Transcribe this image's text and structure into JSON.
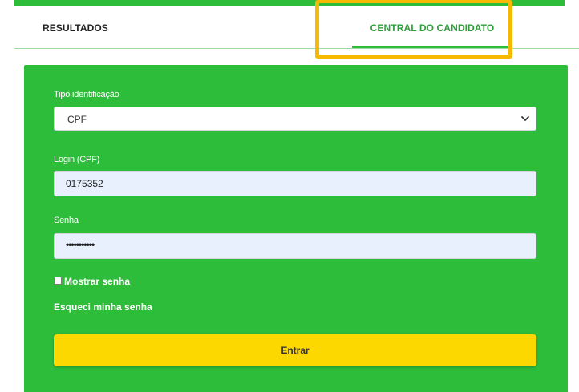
{
  "nav": {
    "tabs": [
      {
        "label": "RESULTADOS",
        "active": false
      },
      {
        "label": "CENTRAL DO CANDIDATO",
        "active": true
      }
    ],
    "highlight_color": "#f6b800"
  },
  "form": {
    "tipo_label": "Tipo identificação",
    "tipo_value": "CPF",
    "login_label": "Login (CPF)",
    "login_value": "0175352",
    "senha_label": "Senha",
    "senha_value": "•••••••••••",
    "show_password_label": "Mostrar senha",
    "show_password_checked": false,
    "forgot_label": "Esqueci minha senha",
    "submit_label": "Entrar"
  },
  "colors": {
    "panel_green": "#2ebd3b",
    "button_yellow": "#fdd800",
    "active_tab_text": "#2e9e3a"
  }
}
